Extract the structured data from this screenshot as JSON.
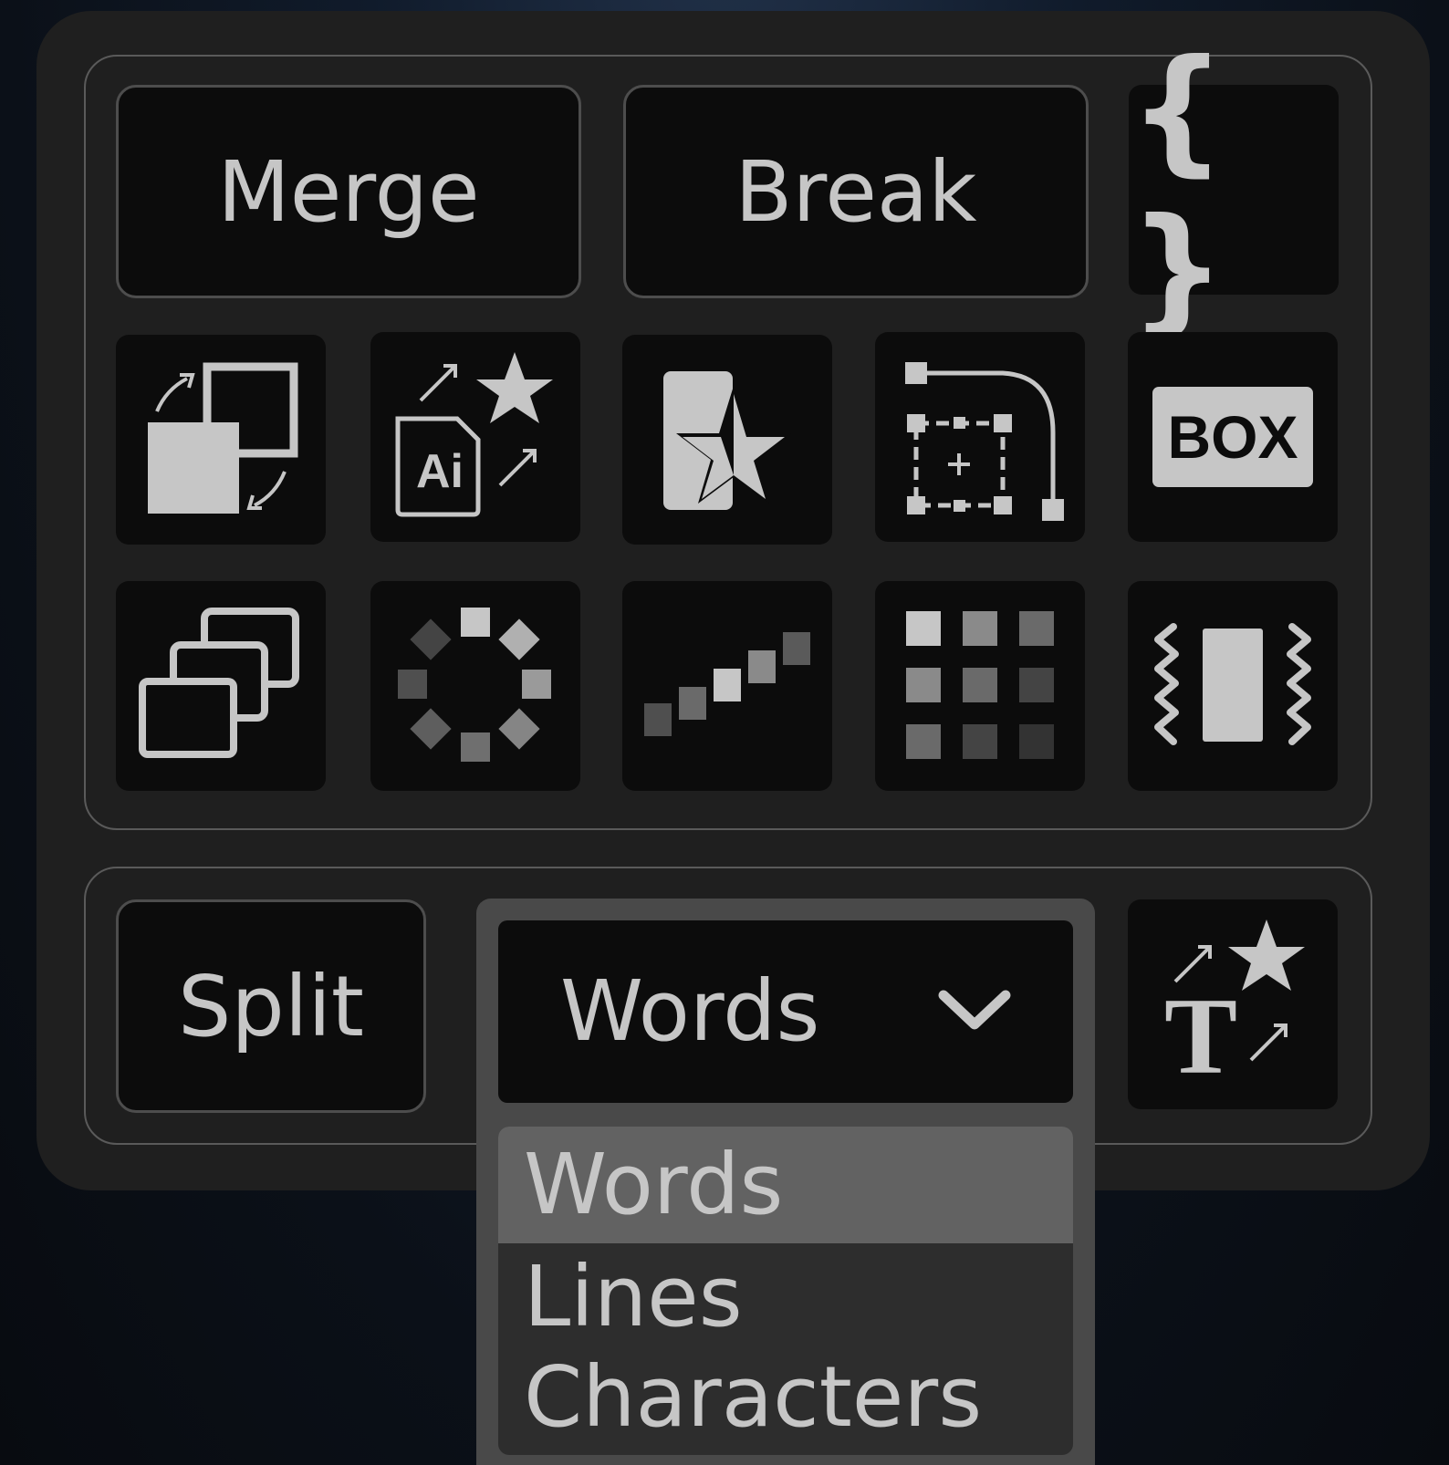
{
  "toolbar": {
    "merge_label": "Merge",
    "break_label": "Break",
    "braces_glyph": "{ }",
    "split_label": "Split",
    "box_badge_text": "BOX",
    "ai_badge_text": "Ai",
    "text_glyph": "T"
  },
  "icons": [
    "expression-braces-icon",
    "swap-layers-icon",
    "import-ai-favorites-icon",
    "favorite-shape-icon",
    "path-bounding-box-icon",
    "box-text-icon",
    "duplicate-stack-icon",
    "radial-repeat-icon",
    "stagger-steps-icon",
    "grid-gradient-icon",
    "wiggle-icon",
    "text-favorites-icon",
    "chevron-down-icon"
  ],
  "split_mode": {
    "selected": "Words",
    "options": [
      "Words",
      "Lines",
      "Characters"
    ]
  },
  "colors": {
    "panel": "#1f1f1f",
    "tile": "#0c0c0c",
    "icon": "#c6c6c6",
    "highlight": "#626262"
  }
}
